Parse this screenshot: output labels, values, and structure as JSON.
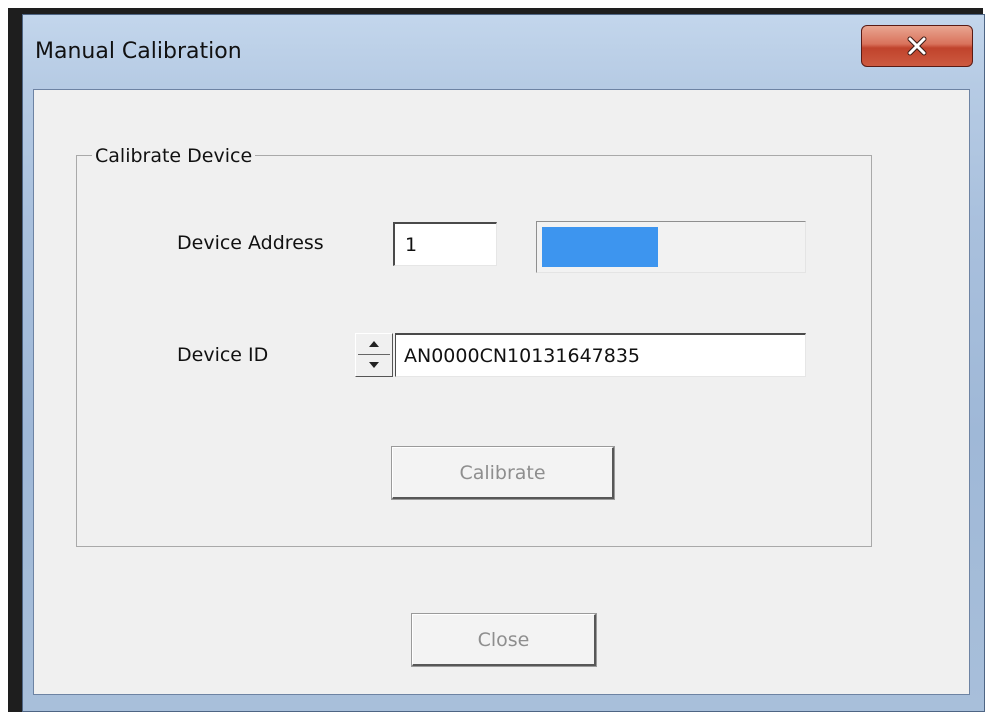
{
  "window": {
    "title": "Manual Calibration",
    "close_icon": "close-x-icon"
  },
  "group": {
    "legend": "Calibrate Device"
  },
  "device_address": {
    "label": "Device Address",
    "value": "1"
  },
  "progress": {
    "fraction": 0.45,
    "color": "#3d95ef"
  },
  "device_id": {
    "label": "Device ID",
    "value": "AN0000CN10131647835",
    "spin_up_icon": "spin-up-icon",
    "spin_down_icon": "spin-down-icon"
  },
  "buttons": {
    "calibrate_label": "Calibrate",
    "close_label": "Close"
  }
}
